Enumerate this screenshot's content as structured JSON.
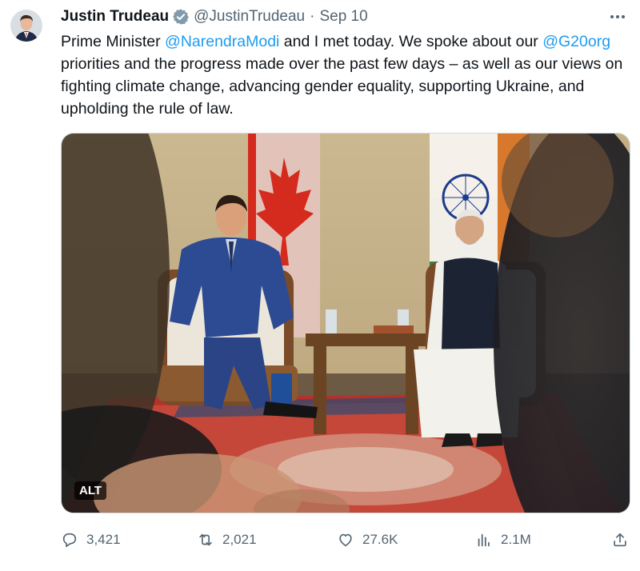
{
  "tweet": {
    "author_name": "Justin Trudeau",
    "handle": "@JustinTrudeau",
    "separator": "·",
    "date": "Sep 10",
    "text": {
      "p1": "Prime Minister ",
      "mention1": "@NarendraModi",
      "p2": " and I met today. We spoke about our ",
      "mention2": "@G20org",
      "p3": " priorities and the progress made over the past few days – as well as our views on fighting climate change, advancing gender equality, supporting Ukraine, and upholding the rule of law."
    },
    "media": {
      "alt_badge": "ALT"
    }
  },
  "actions": {
    "replies": "3,421",
    "retweets": "2,021",
    "likes": "27.6K",
    "views": "2.1M"
  },
  "icons": [
    "avatar",
    "verified-badge-icon",
    "more-icon",
    "reply-icon",
    "retweet-icon",
    "like-icon",
    "views-icon",
    "share-icon"
  ],
  "colors": {
    "link": "#1d9bf0",
    "muted": "#536471",
    "text": "#0f1419"
  }
}
